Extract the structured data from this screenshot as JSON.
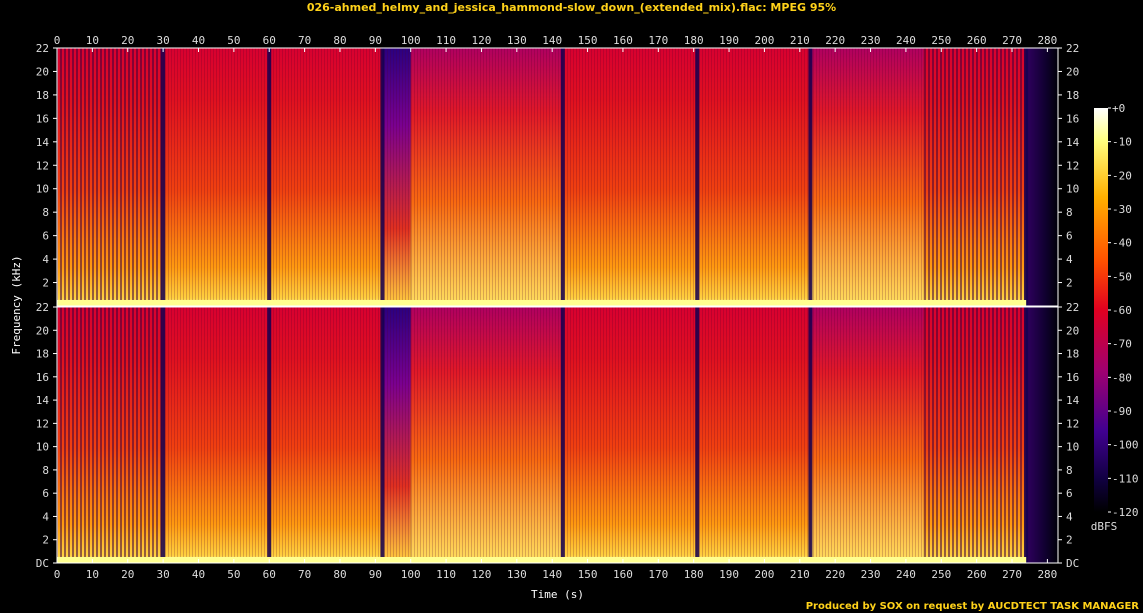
{
  "title": "026-ahmed_helmy_and_jessica_hammond-slow_down_(extended_mix).flac: MPEG 95%",
  "footer": "Produced by SOX on request by AUCDTECT TASK MANAGER",
  "chart_data": {
    "type": "heatmap",
    "title": "026-ahmed_helmy_and_jessica_hammond-slow_down_(extended_mix).flac: MPEG 95%",
    "xlabel": "Time (s)",
    "ylabel": "Frequency (kHz)",
    "xlim": [
      0,
      283
    ],
    "x_ticks": [
      "0",
      "10",
      "20",
      "30",
      "40",
      "50",
      "60",
      "70",
      "80",
      "90",
      "100",
      "110",
      "120",
      "130",
      "140",
      "150",
      "160",
      "170",
      "180",
      "190",
      "200",
      "210",
      "220",
      "230",
      "240",
      "250",
      "260",
      "270",
      "280"
    ],
    "ylim": [
      0,
      22
    ],
    "y_ticks_top": [
      "2",
      "4",
      "6",
      "8",
      "10",
      "12",
      "14",
      "16",
      "18",
      "20",
      "22"
    ],
    "y_ticks_bottom": [
      "DC",
      "2",
      "4",
      "6",
      "8",
      "10",
      "12",
      "14",
      "16",
      "18",
      "20",
      "22"
    ],
    "channels": 2,
    "colorbar": {
      "label": "dBFS",
      "range": [
        -120,
        0
      ],
      "ticks": [
        "+0",
        "-10",
        "-20",
        "-30",
        "-40",
        "-50",
        "-60",
        "-70",
        "-80",
        "-90",
        "-100",
        "-110",
        "-120"
      ]
    },
    "segments": [
      {
        "start": 0,
        "end": 30,
        "level": "pulsing"
      },
      {
        "start": 30,
        "end": 60,
        "level": "loud"
      },
      {
        "start": 60,
        "end": 92,
        "level": "loud"
      },
      {
        "start": 92,
        "end": 100,
        "level": "quiet"
      },
      {
        "start": 100,
        "end": 143,
        "level": "medium"
      },
      {
        "start": 143,
        "end": 213,
        "level": "loud"
      },
      {
        "start": 213,
        "end": 245,
        "level": "medium"
      },
      {
        "start": 245,
        "end": 274,
        "level": "pulsing"
      },
      {
        "start": 274,
        "end": 283,
        "level": "fade"
      }
    ],
    "gaps": [
      30,
      60,
      92,
      143,
      181,
      213,
      274
    ]
  }
}
